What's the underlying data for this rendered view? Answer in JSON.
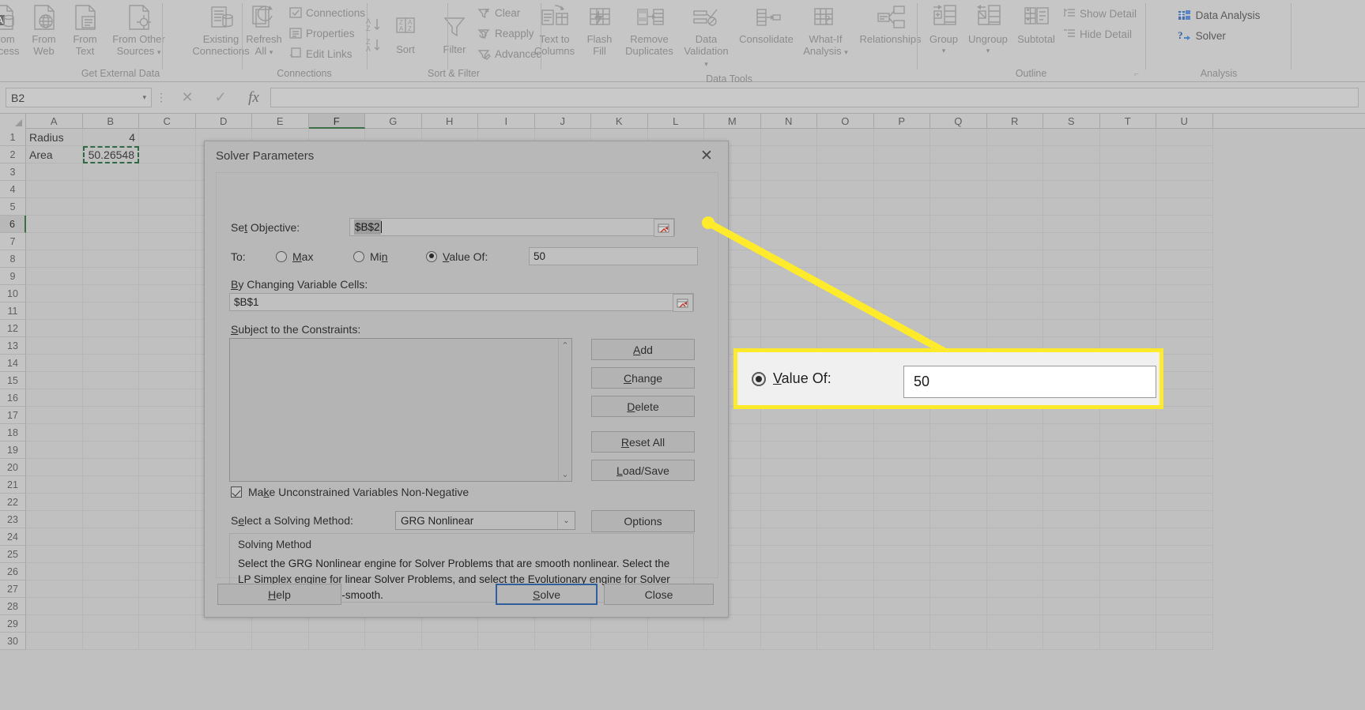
{
  "ribbon": {
    "groups": [
      {
        "caption": "Get External Data",
        "buttons": [
          {
            "label_top": "From",
            "label_bottom": "Access",
            "icon": "from-access-icon"
          },
          {
            "label_top": "From",
            "label_bottom": "Web",
            "icon": "from-web-icon"
          },
          {
            "label_top": "From",
            "label_bottom": "Text",
            "icon": "from-text-icon"
          },
          {
            "label_top": "From Other",
            "label_bottom": "Sources",
            "icon": "from-other-sources-icon",
            "dropdown": true
          },
          {
            "label_top": "Existing",
            "label_bottom": "Connections",
            "icon": "existing-connections-icon"
          }
        ]
      },
      {
        "caption": "Connections",
        "refresh": {
          "label_top": "Refresh",
          "label_bottom": "All",
          "icon": "refresh-all-icon",
          "dropdown": true
        },
        "items": [
          {
            "label": "Connections",
            "icon": "connections-icon"
          },
          {
            "label": "Properties",
            "icon": "properties-icon"
          },
          {
            "label": "Edit Links",
            "icon": "edit-links-icon"
          }
        ]
      },
      {
        "caption": "Sort & Filter",
        "sort_az": "sort-ascending-icon",
        "sort_za": "sort-descending-icon",
        "sort_label": "Sort",
        "filter_label": "Filter",
        "items": [
          {
            "label": "Clear",
            "icon": "clear-filter-icon"
          },
          {
            "label": "Reapply",
            "icon": "reapply-filter-icon"
          },
          {
            "label": "Advanced",
            "icon": "advanced-filter-icon"
          }
        ]
      },
      {
        "caption": "Data Tools",
        "buttons": [
          {
            "label_top": "Text to",
            "label_bottom": "Columns",
            "icon": "text-to-columns-icon"
          },
          {
            "label_top": "Flash",
            "label_bottom": "Fill",
            "icon": "flash-fill-icon"
          },
          {
            "label_top": "Remove",
            "label_bottom": "Duplicates",
            "icon": "remove-duplicates-icon"
          },
          {
            "label_top": "Data",
            "label_bottom": "Validation",
            "icon": "data-validation-icon",
            "dropdown": true
          },
          {
            "label_top": "Consolidate",
            "label_bottom": "",
            "icon": "consolidate-icon"
          },
          {
            "label_top": "What-If",
            "label_bottom": "Analysis",
            "icon": "what-if-analysis-icon",
            "dropdown": true
          },
          {
            "label_top": "Relationships",
            "label_bottom": "",
            "icon": "relationships-icon"
          }
        ]
      },
      {
        "caption": "Outline",
        "buttons": [
          {
            "label_top": "Group",
            "label_bottom": "",
            "icon": "group-icon",
            "dropdown": true
          },
          {
            "label_top": "Ungroup",
            "label_bottom": "",
            "icon": "ungroup-icon",
            "dropdown": true
          },
          {
            "label_top": "Subtotal",
            "label_bottom": "",
            "icon": "subtotal-icon"
          }
        ],
        "items": [
          {
            "label": "Show Detail",
            "icon": "show-detail-icon"
          },
          {
            "label": "Hide Detail",
            "icon": "hide-detail-icon"
          }
        ]
      },
      {
        "caption": "Analysis",
        "items": [
          {
            "label": "Data Analysis",
            "icon": "data-analysis-icon"
          },
          {
            "label": "Solver",
            "icon": "solver-icon"
          }
        ]
      }
    ]
  },
  "formula_bar": {
    "name_box_value": "B2",
    "cancel_icon": "cancel-icon",
    "confirm_icon": "confirm-icon",
    "function_icon": "insert-function-icon",
    "formula_value": ""
  },
  "sheet": {
    "columns": [
      "A",
      "B",
      "C",
      "D",
      "E",
      "F",
      "G",
      "H",
      "I",
      "J",
      "K",
      "L",
      "M",
      "N",
      "O",
      "P",
      "Q",
      "R",
      "S",
      "T",
      "U"
    ],
    "selected_column": "F",
    "row_numbers": [
      1,
      2,
      3,
      4,
      5,
      6,
      7,
      8,
      9,
      10,
      11,
      12,
      13,
      14,
      15,
      16,
      17,
      18,
      19,
      20,
      21,
      22,
      23,
      24,
      25,
      26,
      27,
      28,
      29,
      30
    ],
    "selected_row": 6,
    "cells": [
      {
        "row": 1,
        "col": "A",
        "value": "Radius"
      },
      {
        "row": 1,
        "col": "B",
        "value": "4",
        "align": "right"
      },
      {
        "row": 2,
        "col": "A",
        "value": "Area"
      },
      {
        "row": 2,
        "col": "B",
        "value": "50.26548",
        "align": "right",
        "marching_ants": true
      }
    ]
  },
  "dialog": {
    "title": "Solver Parameters",
    "close_icon": "close-icon",
    "set_objective": {
      "label": "Set Objective:",
      "value": "$B$2",
      "picker_icon": "range-picker-icon"
    },
    "to": {
      "label": "To:",
      "options": [
        {
          "label": "Max",
          "selected": false
        },
        {
          "label": "Min",
          "selected": false
        },
        {
          "label": "Value Of:",
          "selected": true
        }
      ],
      "value_of": "50"
    },
    "changing_cells": {
      "label": "By Changing Variable Cells:",
      "value": "$B$1",
      "picker_icon": "range-picker-icon"
    },
    "constraints": {
      "label": "Subject to the Constraints:",
      "items": [],
      "scroll_up_icon": "chevron-up-icon",
      "scroll_down_icon": "chevron-down-icon"
    },
    "side_buttons": [
      {
        "label": "Add"
      },
      {
        "label": "Change"
      },
      {
        "label": "Delete"
      },
      {
        "label": "Reset All"
      },
      {
        "label": "Load/Save"
      }
    ],
    "non_negative": {
      "label": "Make Unconstrained Variables Non-Negative",
      "checked": true
    },
    "solving_method": {
      "label": "Select a Solving Method:",
      "value": "GRG Nonlinear",
      "dropdown_icon": "chevron-down-icon",
      "options_button": "Options"
    },
    "solving_method_box": {
      "title": "Solving Method",
      "text": "Select the GRG Nonlinear engine for Solver Problems that are smooth nonlinear. Select the LP Simplex engine for linear Solver Problems, and select the Evolutionary engine for Solver problems that are non-smooth."
    },
    "footer": {
      "help": "Help",
      "solve": "Solve",
      "close": "Close"
    }
  },
  "callout": {
    "radio_label": "Value Of:",
    "radio_selected": true,
    "field_value": "50",
    "highlight_color": "#ffeb2a"
  }
}
